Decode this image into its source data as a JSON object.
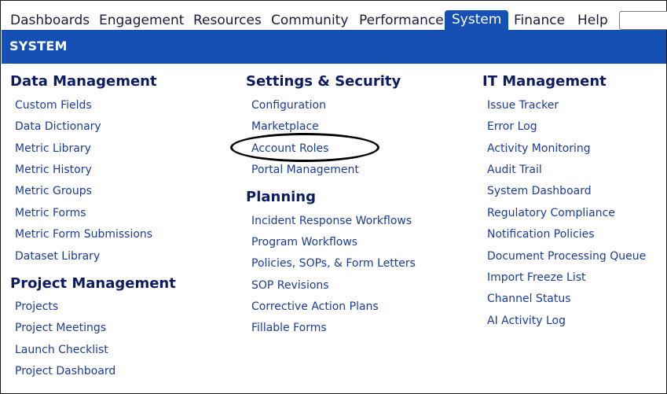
{
  "nav": {
    "tabs": [
      "Dashboards",
      "Engagement",
      "Resources",
      "Community",
      "Performance",
      "System",
      "Finance",
      "Help"
    ],
    "active_tab": "System"
  },
  "banner": {
    "title": "SYSTEM"
  },
  "columns": [
    {
      "sections": [
        {
          "heading": "Data Management",
          "links": [
            "Custom Fields",
            "Data Dictionary",
            "Metric Library",
            "Metric History",
            "Metric Groups",
            "Metric Forms",
            "Metric Form Submissions",
            "Dataset Library"
          ]
        },
        {
          "heading": "Project Management",
          "links": [
            "Projects",
            "Project Meetings",
            "Launch Checklist",
            "Project Dashboard"
          ]
        }
      ]
    },
    {
      "sections": [
        {
          "heading": "Settings & Security",
          "links": [
            "Configuration",
            "Marketplace",
            "Account Roles",
            "Portal Management"
          ]
        },
        {
          "heading": "Planning",
          "links": [
            "Incident Response Workflows",
            "Program Workflows",
            "Policies, SOPs, & Form Letters",
            "SOP Revisions",
            "Corrective Action Plans",
            "Fillable Forms"
          ]
        }
      ]
    },
    {
      "sections": [
        {
          "heading": "IT Management",
          "links": [
            "Issue Tracker",
            "Error Log",
            "Activity Monitoring",
            "Audit Trail",
            "System Dashboard",
            "Regulatory Compliance",
            "Notification Policies",
            "Document Processing Queue",
            "Import Freeze List",
            "Channel Status",
            "AI Activity Log"
          ]
        }
      ]
    }
  ],
  "highlight": {
    "item": "Account Roles",
    "style": "hand-drawn ellipse"
  }
}
